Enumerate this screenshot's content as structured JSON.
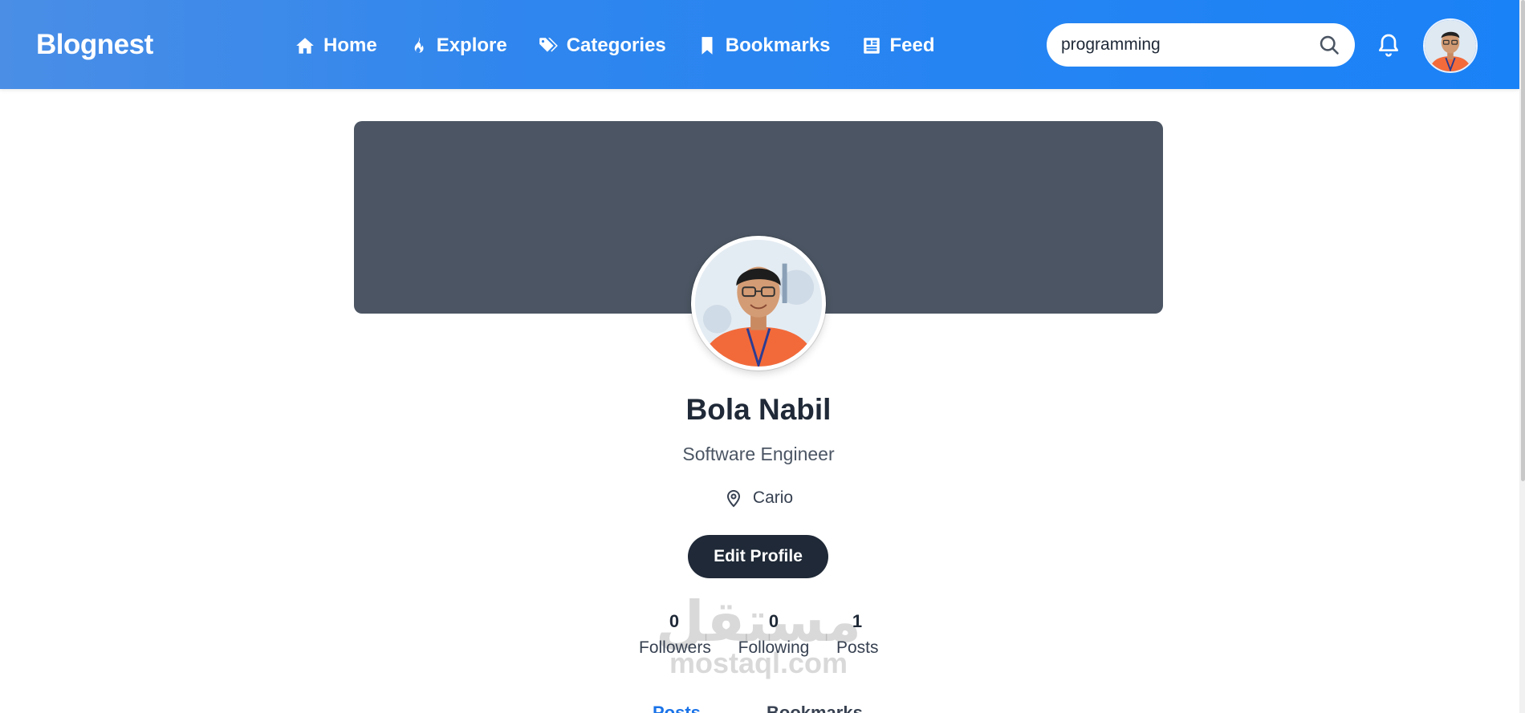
{
  "navbar": {
    "brand": "Blognest",
    "links": [
      {
        "label": "Home",
        "icon": "home-icon"
      },
      {
        "label": "Explore",
        "icon": "flame-icon"
      },
      {
        "label": "Categories",
        "icon": "tags-icon"
      },
      {
        "label": "Bookmarks",
        "icon": "bookmark-icon"
      },
      {
        "label": "Feed",
        "icon": "newspaper-icon"
      }
    ],
    "search": {
      "value": "programming",
      "icon": "search-icon"
    },
    "notifications_icon": "bell-icon",
    "colors": {
      "gradient_start": "#4a8ee6",
      "gradient_end": "#1a82f7"
    }
  },
  "profile": {
    "name": "Bola Nabil",
    "title": "Software Engineer",
    "location": "Cario",
    "location_icon": "map-pin-icon",
    "edit_button": "Edit Profile",
    "cover_color": "#4b5563",
    "stats": [
      {
        "value": "0",
        "label": "Followers"
      },
      {
        "value": "0",
        "label": "Following"
      },
      {
        "value": "1",
        "label": "Posts"
      }
    ],
    "tabs": [
      "Posts",
      "Bookmarks"
    ]
  },
  "watermark": {
    "arabic": "مستقل",
    "latin": "mostaql.com"
  }
}
